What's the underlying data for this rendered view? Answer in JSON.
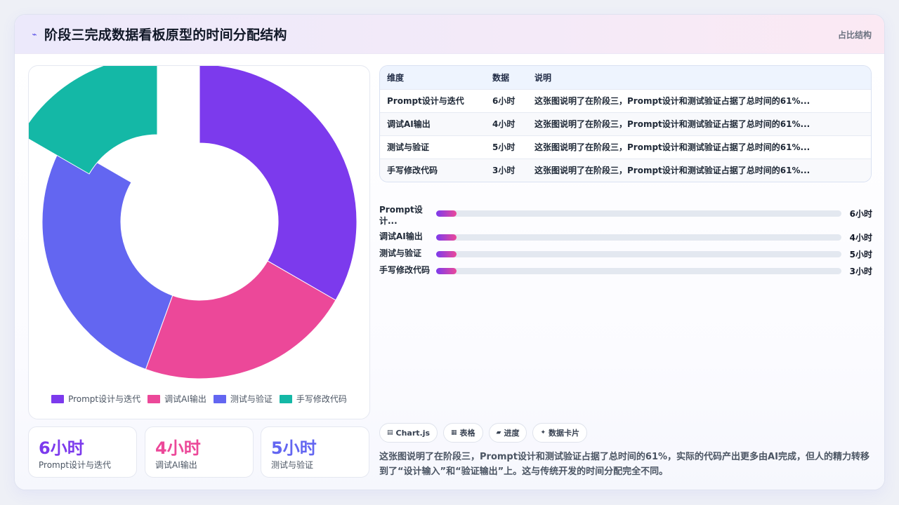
{
  "header": {
    "icon": "sparkle-icon",
    "title": "阶段三完成数据看板原型的时间分配结构",
    "tag": "占比结构"
  },
  "colors": {
    "purple": "#7c3aed",
    "pink": "#ec4899",
    "indigo": "#6366f1",
    "teal": "#14b8a6"
  },
  "chart_data": {
    "type": "pie",
    "variant": "doughnut",
    "categories": [
      "Prompt设计与迭代",
      "调试AI输出",
      "测试与验证",
      "手写修改代码"
    ],
    "values": [
      6,
      4,
      5,
      3
    ],
    "unit": "小时",
    "colors": [
      "#7c3aed",
      "#ec4899",
      "#6366f1",
      "#14b8a6"
    ],
    "legend_position": "bottom"
  },
  "legend": [
    {
      "label": "Prompt设计与迭代",
      "color": "#7c3aed"
    },
    {
      "label": "调试AI输出",
      "color": "#ec4899"
    },
    {
      "label": "测试与验证",
      "color": "#6366f1"
    },
    {
      "label": "手写修改代码",
      "color": "#14b8a6"
    }
  ],
  "stats": [
    {
      "value": "6小时",
      "label": "Prompt设计与迭代",
      "color": "#7c3aed"
    },
    {
      "value": "4小时",
      "label": "调试AI输出",
      "color": "#ec4899"
    },
    {
      "value": "5小时",
      "label": "测试与验证",
      "color": "#6366f1"
    }
  ],
  "table": {
    "headers": [
      "维度",
      "数据",
      "说明"
    ],
    "rows": [
      [
        "Prompt设计与迭代",
        "6小时",
        "这张图说明了在阶段三，Prompt设计和测试验证占据了总时间的61%..."
      ],
      [
        "调试AI输出",
        "4小时",
        "这张图说明了在阶段三，Prompt设计和测试验证占据了总时间的61%..."
      ],
      [
        "测试与验证",
        "5小时",
        "这张图说明了在阶段三，Prompt设计和测试验证占据了总时间的61%..."
      ],
      [
        "手写修改代码",
        "3小时",
        "这张图说明了在阶段三，Prompt设计和测试验证占据了总时间的61%..."
      ]
    ]
  },
  "progress": [
    {
      "label": "Prompt设计...",
      "value": "6小时",
      "fill": 0.05
    },
    {
      "label": "调试AI输出",
      "value": "4小时",
      "fill": 0.05
    },
    {
      "label": "测试与验证",
      "value": "5小时",
      "fill": 0.05
    },
    {
      "label": "手写修改代码",
      "value": "3小时",
      "fill": 0.05
    }
  ],
  "tabs": [
    {
      "label": "Chart.js",
      "icon": "chart-icon",
      "glyph": "▤"
    },
    {
      "label": "表格",
      "icon": "table-icon",
      "glyph": "▦"
    },
    {
      "label": "进度",
      "icon": "progress-icon",
      "glyph": "▰"
    },
    {
      "label": "数据卡片",
      "icon": "card-icon",
      "glyph": "✦"
    }
  ],
  "summary": "这张图说明了在阶段三，Prompt设计和测试验证占据了总时间的61%，实际的代码产出更多由AI完成，但人的精力转移到了“设计输入”和“验证输出”上。这与传统开发的时间分配完全不同。"
}
